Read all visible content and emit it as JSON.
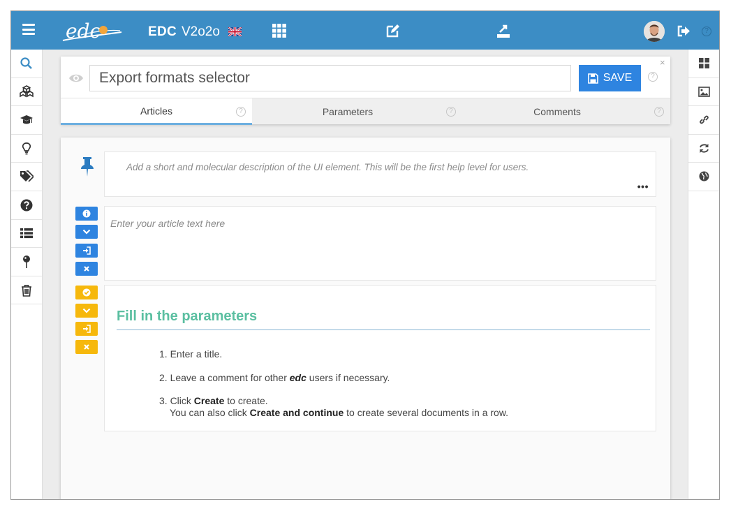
{
  "topbar": {
    "app_name": "EDC",
    "app_version": "V2o2o",
    "logo_text": "edc"
  },
  "left_sidebar": {
    "items": [
      {
        "icon": "search-icon",
        "active": true
      },
      {
        "icon": "cubes-icon"
      },
      {
        "icon": "graduation-cap-icon"
      },
      {
        "icon": "lightbulb-icon"
      },
      {
        "icon": "tags-icon"
      },
      {
        "icon": "question-circle-icon"
      },
      {
        "icon": "list-icon"
      },
      {
        "icon": "map-pin-icon"
      },
      {
        "icon": "trash-icon"
      }
    ]
  },
  "right_sidebar": {
    "items": [
      "grid-icon",
      "image-icon",
      "link-icon",
      "refresh-icon",
      "globe-icon"
    ]
  },
  "editor": {
    "title": "Export formats selector",
    "save_label": "SAVE",
    "help_glyph": "?",
    "close_glyph": "×"
  },
  "tabs": [
    {
      "label": "Articles",
      "active": true
    },
    {
      "label": "Parameters",
      "active": false
    },
    {
      "label": "Comments",
      "active": false
    }
  ],
  "content": {
    "description_placeholder": "Add a short and molecular description of the UI element. This will be the first help level for users.",
    "more_label": "•••",
    "article_placeholder": "Enter your article text here",
    "parameters_heading": "Fill in the parameters",
    "steps": {
      "s1": "1. Enter a title.",
      "s2_a": "2. Leave a comment for other ",
      "s2_b": "edc",
      "s2_c": " users if necessary.",
      "s3_a": "3. Click ",
      "s3_b": "Create",
      "s3_c": " to create.",
      "s3_d": "You can also click ",
      "s3_e": "Create and continue",
      "s3_f": " to create several documents in a row."
    }
  },
  "colors": {
    "topbar": "#3c8dc5",
    "save_button": "#2e84e0",
    "blue_tool": "#2e84e0",
    "yellow_tool": "#f6b80c",
    "heading": "#5bbfa1"
  }
}
